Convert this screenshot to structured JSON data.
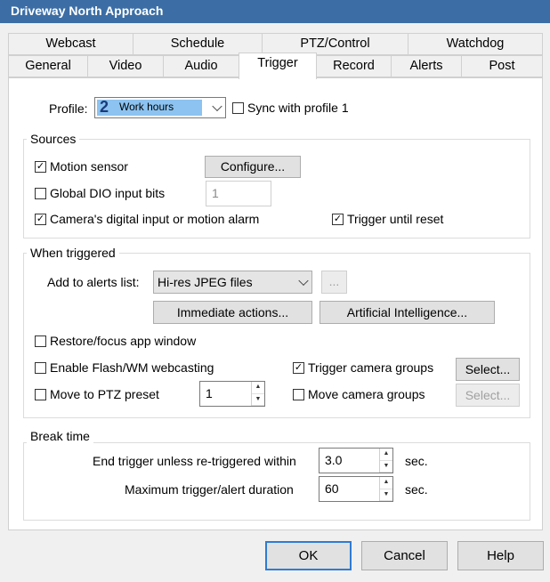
{
  "window": {
    "title": "Driveway North Approach"
  },
  "tabs_row1": [
    "Webcast",
    "Schedule",
    "PTZ/Control",
    "Watchdog"
  ],
  "tabs_row2": [
    "General",
    "Video",
    "Audio",
    "Trigger",
    "Record",
    "Alerts",
    "Post"
  ],
  "active_tab": "Trigger",
  "profile": {
    "label": "Profile:",
    "number": "2",
    "value": "Work hours",
    "sync_label": "Sync with profile 1",
    "sync_checked": false,
    "accent": "#8cc3f0"
  },
  "sources": {
    "title": "Sources",
    "motion_sensor": {
      "label": "Motion sensor",
      "checked": true
    },
    "configure_button": "Configure...",
    "global_dio": {
      "label": "Global DIO input bits",
      "checked": false,
      "value": "1"
    },
    "camera_digital": {
      "label": "Camera's digital input or motion alarm",
      "checked": true
    },
    "trigger_until_reset": {
      "label": "Trigger until reset",
      "checked": true
    }
  },
  "when_triggered": {
    "title": "When triggered",
    "alerts_label": "Add to alerts list:",
    "alerts_value": "Hi-res JPEG files",
    "ellipsis_button": "...",
    "immediate_button": "Immediate actions...",
    "ai_button": "Artificial Intelligence...",
    "restore_focus": {
      "label": "Restore/focus app window",
      "checked": false
    },
    "flash_webcast": {
      "label": "Enable Flash/WM webcasting",
      "checked": false
    },
    "trigger_groups": {
      "label": "Trigger camera groups",
      "checked": true
    },
    "select_button": "Select...",
    "ptz_preset": {
      "label": "Move to PTZ preset",
      "checked": false,
      "value": "1"
    },
    "move_groups": {
      "label": "Move camera groups",
      "checked": false
    },
    "select_disabled_button": "Select..."
  },
  "break_time": {
    "title": "Break time",
    "end_label": "End trigger unless re-triggered within",
    "end_value": "3.0",
    "max_label": "Maximum trigger/alert duration",
    "max_value": "60",
    "unit": "sec."
  },
  "buttons": {
    "ok": "OK",
    "cancel": "Cancel",
    "help": "Help"
  }
}
